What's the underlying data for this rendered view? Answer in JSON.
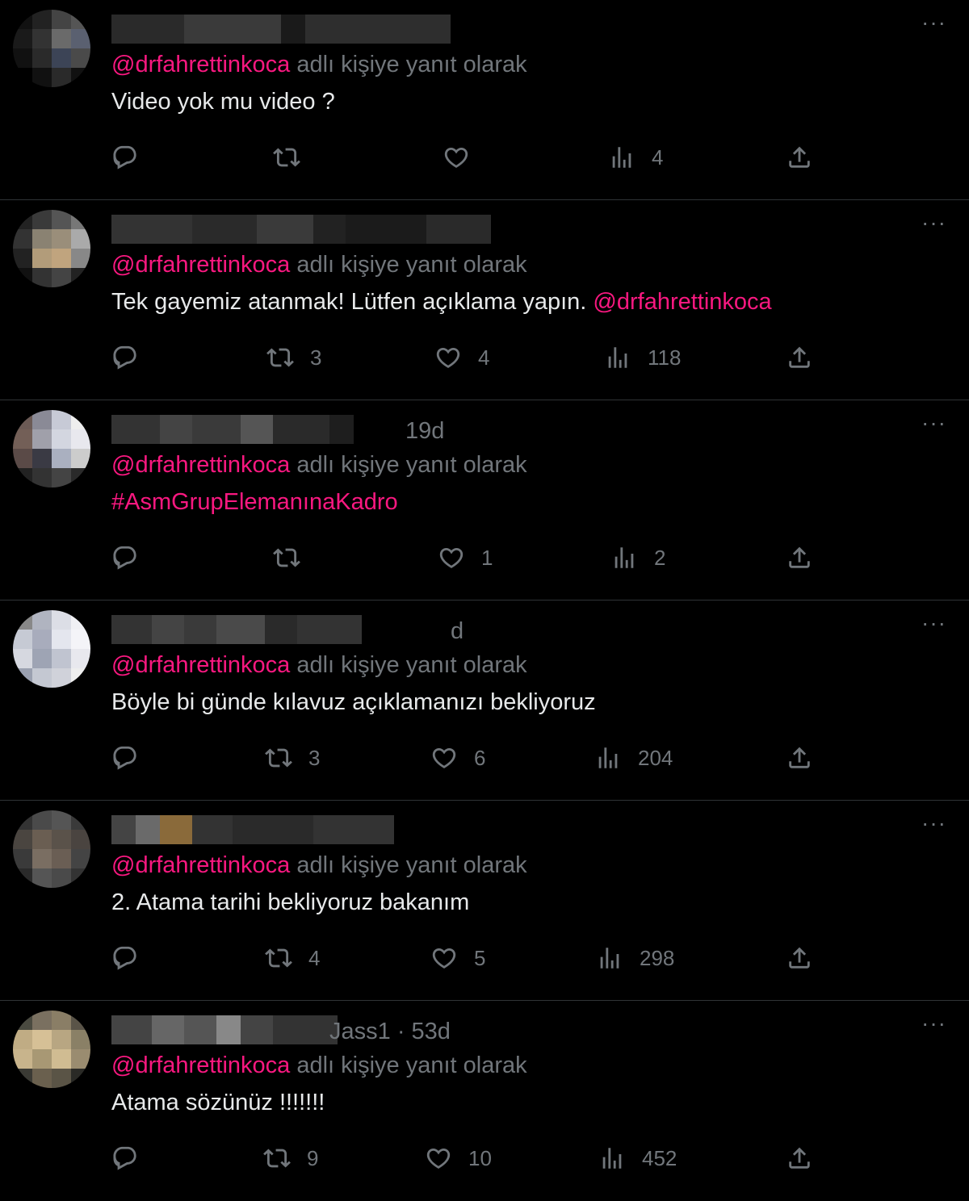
{
  "common": {
    "reply_prefix": "@drfahrettinkoca",
    "reply_suffix": " adlı kişiye yanıt olarak",
    "more": "···"
  },
  "tweets": [
    {
      "meta": "",
      "text_plain": "Video yok mu video ?",
      "text_tag": "",
      "replies": "",
      "retweets": "",
      "likes": "",
      "views": "4",
      "name_blocks": [
        "#2a2a2a",
        "#3a3a3a",
        "#1a1a1a",
        "#2e2e2e"
      ],
      "avatar": [
        "#111",
        "#222",
        "#444",
        "#555",
        "#1a1a1a",
        "#333",
        "#6a6a6a",
        "#5a6070",
        "#111",
        "#2a2a2a",
        "#3c4456",
        "#4a4a4a",
        "#000",
        "#111",
        "#2a2a2a",
        "#111"
      ]
    },
    {
      "meta": "",
      "text_plain": "Tek gayemiz atanmak! Lütfen açıklama yapın. ",
      "text_tag": "@drfahrettinkoca",
      "replies": "",
      "retweets": "3",
      "likes": "4",
      "views": "118",
      "name_blocks": [
        "#333",
        "#2a2a2a",
        "#3a3a3a",
        "#222",
        "#1b1b1b",
        "#2a2a2a"
      ],
      "avatar": [
        "#222",
        "#3a3a3a",
        "#555",
        "#777",
        "#333",
        "#8a8272",
        "#9a8e7a",
        "#aaaaaa",
        "#222",
        "#b29c7a",
        "#c0a47e",
        "#888",
        "#111",
        "#333",
        "#444",
        "#222"
      ]
    },
    {
      "meta": "19d",
      "text_plain": "",
      "text_tag": "#AsmGrupElemanınaKadro",
      "replies": "",
      "retweets": "",
      "likes": "1",
      "views": "2",
      "name_blocks": [
        "#333",
        "#444",
        "#3a3a3a",
        "#555",
        "#2a2a2a",
        "#1e1e1e"
      ],
      "avatar": [
        "#6b5a55",
        "#8a8a96",
        "#c7cad6",
        "#eeeeee",
        "#735f57",
        "#a0a0aa",
        "#d3d6e0",
        "#e8e8ee",
        "#5a4a47",
        "#3a3a44",
        "#aab0c0",
        "#cccccc",
        "#222",
        "#333",
        "#444",
        "#2a2a2a"
      ]
    },
    {
      "meta": "d",
      "text_plain": "Böyle bi günde kılavuz açıklamanızı bekliyoruz",
      "text_tag": "",
      "replies": "",
      "retweets": "3",
      "likes": "6",
      "views": "204",
      "name_blocks": [
        "#333",
        "#444",
        "#3a3a3a",
        "#4a4a4a",
        "#2a2a2a",
        "#333"
      ],
      "avatar": [
        "#888",
        "#b0b4c0",
        "#dcdee6",
        "#f0f0f4",
        "#c6cad4",
        "#a8acbc",
        "#e4e6ee",
        "#f4f4f8",
        "#d6d8e0",
        "#9ea4b4",
        "#c0c4d0",
        "#e8e8ee",
        "#9aa0b0",
        "#c4c8d2",
        "#d0d2da",
        "#eeeeee"
      ]
    },
    {
      "meta": "",
      "text_plain": "2. Atama tarihi bekliyoruz bakanım",
      "text_tag": "",
      "replies": "",
      "retweets": "4",
      "likes": "5",
      "views": "298",
      "name_blocks": [
        "#444",
        "#6a6a6a",
        "#8a6a3a",
        "#333",
        "#2a2a2a",
        "#333"
      ],
      "avatar": [
        "#333",
        "#4a4a4a",
        "#555",
        "#3a3a3a",
        "#4a4540",
        "#6a5e52",
        "#5a524a",
        "#4a4440",
        "#3a3a3a",
        "#7a6e62",
        "#6a5e54",
        "#444",
        "#2a2a2a",
        "#555",
        "#4a4a4a",
        "#333"
      ]
    },
    {
      "meta": "Jass1 · 53d",
      "text_plain": "Atama sözünüz !!!!!!!",
      "text_tag": "",
      "replies": "",
      "retweets": "9",
      "likes": "10",
      "views": "452",
      "name_blocks": [
        "#444",
        "#666",
        "#555",
        "#888",
        "#444",
        "#333"
      ],
      "avatar": [
        "#4a4a40",
        "#7a7060",
        "#8a7e66",
        "#5a5448",
        "#c0ac84",
        "#d6c096",
        "#b8a682",
        "#8a8066",
        "#c8b48c",
        "#a89874",
        "#d0bc92",
        "#9a8c70",
        "#3a3a34",
        "#6a604e",
        "#5a5446",
        "#2a2a26"
      ]
    }
  ]
}
